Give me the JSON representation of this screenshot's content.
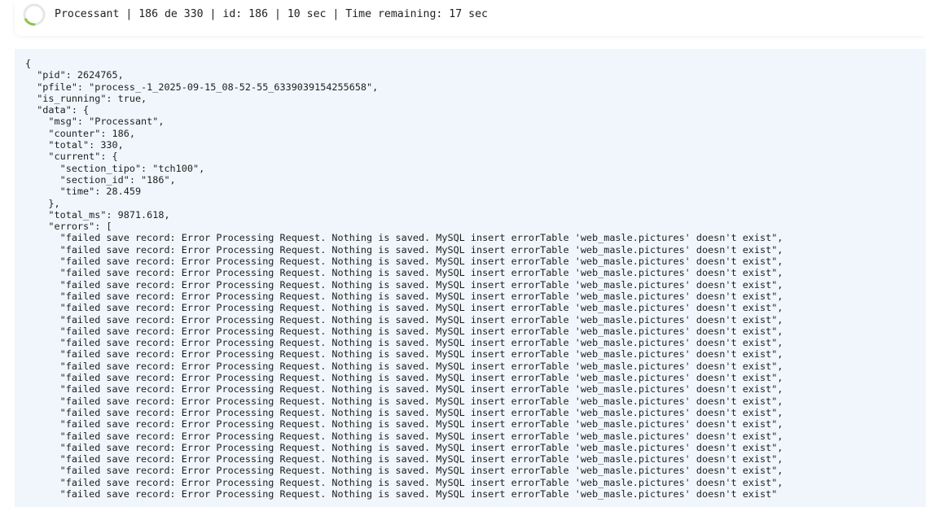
{
  "status": {
    "text": "Processant | 186 de 330 | id: 186 | 10 sec | Time remaining: 17 sec"
  },
  "log": {
    "lines": [
      "{",
      "  \"pid\": 2624765,",
      "  \"pfile\": \"process_-1_2025-09-15_08-52-55_6339039154255658\",",
      "  \"is_running\": true,",
      "  \"data\": {",
      "    \"msg\": \"Processant\",",
      "    \"counter\": 186,",
      "    \"total\": 330,",
      "    \"current\": {",
      "      \"section_tipo\": \"tch100\",",
      "      \"section_id\": \"186\",",
      "      \"time\": 28.459",
      "    },",
      "    \"total_ms\": 9871.618,",
      "    \"errors\": [",
      "      \"failed save record: Error Processing Request. Nothing is saved. MySQL insert errorTable 'web_masle.pictures' doesn't exist\",",
      "      \"failed save record: Error Processing Request. Nothing is saved. MySQL insert errorTable 'web_masle.pictures' doesn't exist\",",
      "      \"failed save record: Error Processing Request. Nothing is saved. MySQL insert errorTable 'web_masle.pictures' doesn't exist\",",
      "      \"failed save record: Error Processing Request. Nothing is saved. MySQL insert errorTable 'web_masle.pictures' doesn't exist\",",
      "      \"failed save record: Error Processing Request. Nothing is saved. MySQL insert errorTable 'web_masle.pictures' doesn't exist\",",
      "      \"failed save record: Error Processing Request. Nothing is saved. MySQL insert errorTable 'web_masle.pictures' doesn't exist\",",
      "      \"failed save record: Error Processing Request. Nothing is saved. MySQL insert errorTable 'web_masle.pictures' doesn't exist\",",
      "      \"failed save record: Error Processing Request. Nothing is saved. MySQL insert errorTable 'web_masle.pictures' doesn't exist\",",
      "      \"failed save record: Error Processing Request. Nothing is saved. MySQL insert errorTable 'web_masle.pictures' doesn't exist\",",
      "      \"failed save record: Error Processing Request. Nothing is saved. MySQL insert errorTable 'web_masle.pictures' doesn't exist\",",
      "      \"failed save record: Error Processing Request. Nothing is saved. MySQL insert errorTable 'web_masle.pictures' doesn't exist\",",
      "      \"failed save record: Error Processing Request. Nothing is saved. MySQL insert errorTable 'web_masle.pictures' doesn't exist\",",
      "      \"failed save record: Error Processing Request. Nothing is saved. MySQL insert errorTable 'web_masle.pictures' doesn't exist\",",
      "      \"failed save record: Error Processing Request. Nothing is saved. MySQL insert errorTable 'web_masle.pictures' doesn't exist\",",
      "      \"failed save record: Error Processing Request. Nothing is saved. MySQL insert errorTable 'web_masle.pictures' doesn't exist\",",
      "      \"failed save record: Error Processing Request. Nothing is saved. MySQL insert errorTable 'web_masle.pictures' doesn't exist\",",
      "      \"failed save record: Error Processing Request. Nothing is saved. MySQL insert errorTable 'web_masle.pictures' doesn't exist\",",
      "      \"failed save record: Error Processing Request. Nothing is saved. MySQL insert errorTable 'web_masle.pictures' doesn't exist\",",
      "      \"failed save record: Error Processing Request. Nothing is saved. MySQL insert errorTable 'web_masle.pictures' doesn't exist\",",
      "      \"failed save record: Error Processing Request. Nothing is saved. MySQL insert errorTable 'web_masle.pictures' doesn't exist\",",
      "      \"failed save record: Error Processing Request. Nothing is saved. MySQL insert errorTable 'web_masle.pictures' doesn't exist\",",
      "      \"failed save record: Error Processing Request. Nothing is saved. MySQL insert errorTable 'web_masle.pictures' doesn't exist\",",
      "      \"failed save record: Error Processing Request. Nothing is saved. MySQL insert errorTable 'web_masle.pictures' doesn't exist\""
    ]
  },
  "theme": {
    "panel_bg": "#f1f6fc",
    "spinner_track": "#e6e6e6",
    "spinner_arc": "#8fc24a"
  }
}
